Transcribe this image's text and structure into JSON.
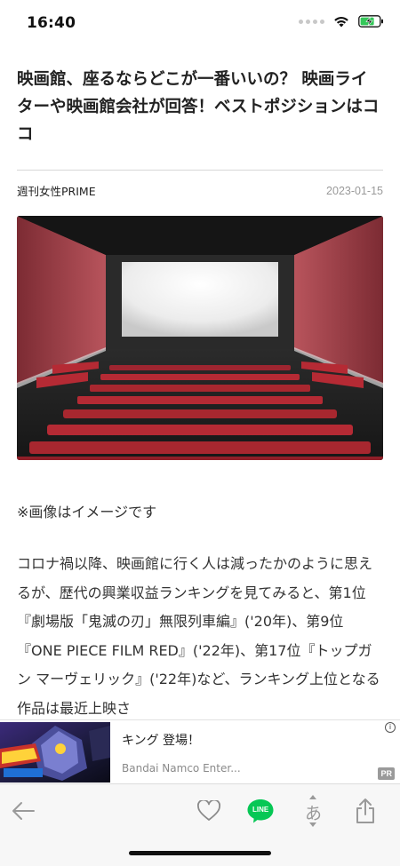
{
  "status": {
    "time": "16:40"
  },
  "article": {
    "title": "映画館、座るならどこが一番いいの？ 映画ライターや映画館会社が回答！ベストポジションはココ",
    "source": "週刊女性PRIME",
    "date": "2023-01-15",
    "image_caption": "※画像はイメージです",
    "body": "コロナ禍以降、映画館に行く人は減ったかのように思えるが、歴代の興業収益ランキングを見てみると、第1位『劇場版「鬼滅の刃」無限列車編』('20年)、第9位『ONE PIECE FILM RED』('22年)、第17位『トップガン マーヴェリック』('22年)など、ランキング上位となる作品は最近上映さ"
  },
  "ad": {
    "title": "キング 登場！",
    "sponsor": "Bandai Namco Enter...",
    "info_glyph": "i",
    "pr_label": "PR"
  },
  "toolbar": {
    "line_label": "LINE",
    "font_glyph": "あ"
  },
  "icons": {
    "back": "back-arrow-icon",
    "like": "heart-icon",
    "line": "line-share-icon",
    "font": "font-size-icon",
    "share": "share-icon"
  },
  "colors": {
    "line_green": "#06c755",
    "screen_wall": "#a9424c",
    "seat_red": "#b52a34"
  }
}
